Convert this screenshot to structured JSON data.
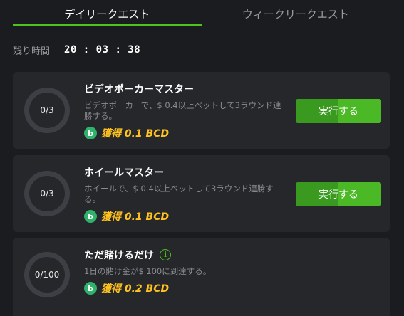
{
  "tabs": [
    {
      "label": "デイリークエスト",
      "active": true
    },
    {
      "label": "ウィークリークエスト",
      "active": false
    }
  ],
  "timer": {
    "label": "残り時間",
    "value": "20 : 03 : 38"
  },
  "quests": [
    {
      "progress": "0/3",
      "title": "ビデオポーカーマスター",
      "description": "ビデオポーカーで、$ 0.4以上ベットして3ラウンド連勝する。",
      "reward": "獲得 0.1 BCD",
      "button": "実行する"
    },
    {
      "progress": "0/3",
      "title": "ホイールマスター",
      "description": "ホイールで、$ 0.4以上ベットして3ラウンド連勝する。",
      "reward": "獲得 0.1 BCD",
      "button": "実行する"
    },
    {
      "progress": "0/100",
      "title": "ただ賭けるだけ",
      "description": "1日の賭け金が$ 100に到達する。",
      "reward": "獲得 0.2 BCD"
    }
  ],
  "icons": {
    "coin": "bc-coin-icon",
    "info": "info-icon"
  },
  "colors": {
    "accent": "#4ec21d",
    "reward": "#ffc21f",
    "button": "#3a9a1f"
  }
}
